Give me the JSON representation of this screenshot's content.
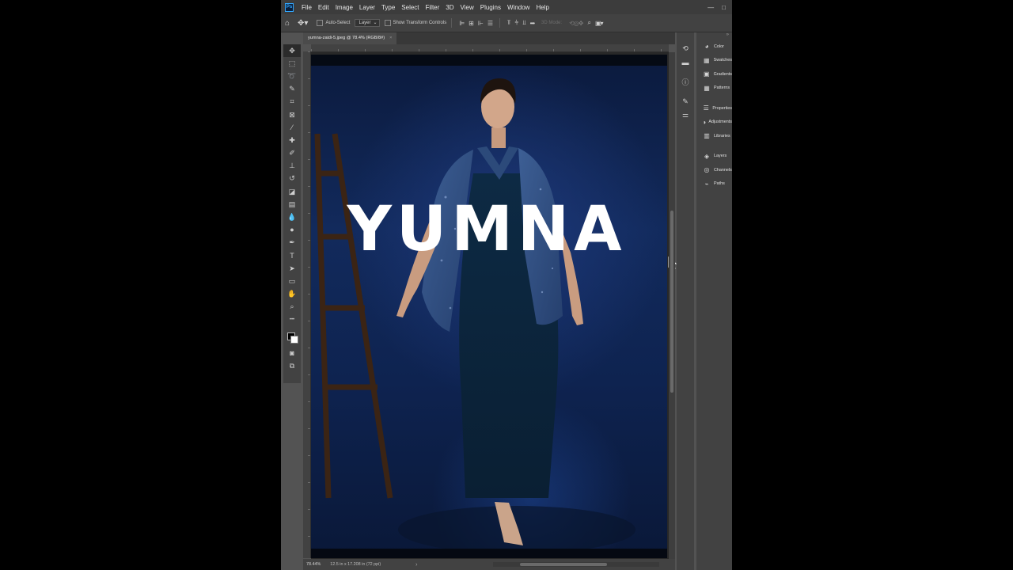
{
  "menubar": {
    "logo": "Ps",
    "items": [
      "File",
      "Edit",
      "Image",
      "Layer",
      "Type",
      "Select",
      "Filter",
      "3D",
      "View",
      "Plugins",
      "Window",
      "Help"
    ],
    "window_controls": [
      "—",
      "□"
    ]
  },
  "options_bar": {
    "auto_select_label": "Auto-Select",
    "auto_select_target": "Layer",
    "show_transform_label": "Show Transform Controls",
    "mode_3d_label": "3D Mode:"
  },
  "document": {
    "tab_title": "yumna-zaidi-5.jpeg @ 78.4% (RGB/8#)",
    "close_glyph": "×"
  },
  "canvas": {
    "overlay_text": "YUMNA"
  },
  "statusbar": {
    "zoom": "78.44%",
    "doc_size": "12.5 in x 17.208 in (72 ppi)",
    "arrow": "›"
  },
  "tools": [
    {
      "name": "move-tool-icon",
      "glyph": "✥",
      "active": true
    },
    {
      "name": "marquee-tool-icon",
      "glyph": "⬚"
    },
    {
      "name": "lasso-tool-icon",
      "glyph": "➰"
    },
    {
      "name": "quick-select-tool-icon",
      "glyph": "✎"
    },
    {
      "name": "crop-tool-icon",
      "glyph": "⌗"
    },
    {
      "name": "frame-tool-icon",
      "glyph": "⊠"
    },
    {
      "name": "eyedropper-tool-icon",
      "glyph": "⁄"
    },
    {
      "name": "healing-brush-tool-icon",
      "glyph": "✚"
    },
    {
      "name": "brush-tool-icon",
      "glyph": "✐"
    },
    {
      "name": "clone-stamp-tool-icon",
      "glyph": "⊥"
    },
    {
      "name": "history-brush-tool-icon",
      "glyph": "↺"
    },
    {
      "name": "eraser-tool-icon",
      "glyph": "◪"
    },
    {
      "name": "gradient-tool-icon",
      "glyph": "▤"
    },
    {
      "name": "blur-tool-icon",
      "glyph": "💧"
    },
    {
      "name": "dodge-tool-icon",
      "glyph": "●"
    },
    {
      "name": "pen-tool-icon",
      "glyph": "✒"
    },
    {
      "name": "type-tool-icon",
      "glyph": "T"
    },
    {
      "name": "path-selection-tool-icon",
      "glyph": "➤"
    },
    {
      "name": "rectangle-tool-icon",
      "glyph": "▭"
    },
    {
      "name": "hand-tool-icon",
      "glyph": "✋"
    },
    {
      "name": "zoom-tool-icon",
      "glyph": "⌕"
    },
    {
      "name": "more-tools-icon",
      "glyph": "•••"
    }
  ],
  "tools_bottom": [
    {
      "name": "quick-mask-icon",
      "glyph": "◙"
    },
    {
      "name": "screen-mode-icon",
      "glyph": "⧉"
    }
  ],
  "panel_strip": [
    {
      "name": "history-panel-icon",
      "glyph": "⟲"
    },
    {
      "name": "comments-panel-icon",
      "glyph": "▬"
    },
    {
      "name": "info-panel-icon",
      "glyph": "ⓘ"
    },
    {
      "name": "brushes-panel-icon",
      "glyph": "✎"
    },
    {
      "name": "adjust-panel-icon",
      "glyph": "⚌"
    }
  ],
  "panels": [
    {
      "name": "panel-color",
      "glyph": "◕",
      "label": "Color"
    },
    {
      "name": "panel-swatches",
      "glyph": "▦",
      "label": "Swatches"
    },
    {
      "name": "panel-gradients",
      "glyph": "▣",
      "label": "Gradients"
    },
    {
      "name": "panel-patterns",
      "glyph": "▦",
      "label": "Patterns"
    },
    {
      "name": "gap"
    },
    {
      "name": "panel-properties",
      "glyph": "☰",
      "label": "Properties"
    },
    {
      "name": "panel-adjustments",
      "glyph": "◑",
      "label": "Adjustments"
    },
    {
      "name": "panel-libraries",
      "glyph": "▥",
      "label": "Libraries"
    },
    {
      "name": "gap"
    },
    {
      "name": "panel-layers",
      "glyph": "◈",
      "label": "Layers"
    },
    {
      "name": "panel-channels",
      "glyph": "◎",
      "label": "Channels"
    },
    {
      "name": "panel-paths",
      "glyph": "⌁",
      "label": "Paths"
    }
  ]
}
